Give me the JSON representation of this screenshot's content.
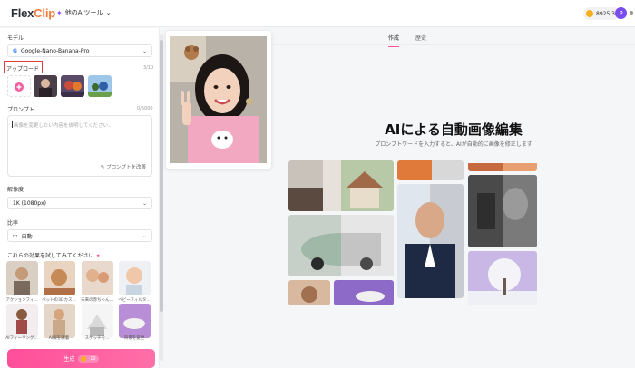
{
  "header": {
    "logo_main": "Flex",
    "logo_accent": "Clip",
    "tools_menu": "他のAIツール",
    "credits": "8925.3",
    "avatar_initial": "P"
  },
  "left_panel": {
    "model_label": "モデル",
    "model_value": "Google-Nano-Banana-Pro",
    "upload_label": "アップロード",
    "upload_count": "3/10",
    "prompt_label": "プロンプト",
    "prompt_count": "0/5000",
    "prompt_placeholder": "画像を変更したい内容を説明してください...",
    "prompt_enhance": "プロンプトを改善",
    "resolution_label": "解像度",
    "resolution_value": "1K (1080px)",
    "ratio_label": "比率",
    "ratio_value": "自動",
    "effects_title": "これらの効果を試してみてください",
    "effects": [
      {
        "label": "アクションフィ..."
      },
      {
        "label": "ペットの3Dカス..."
      },
      {
        "label": "未来の赤ちゃん..."
      },
      {
        "label": "ベビーフィルタ..."
      },
      {
        "label": "AIフィーリング..."
      },
      {
        "label": "AI服を試着"
      },
      {
        "label": "スケッチを..."
      },
      {
        "label": "背景を変更"
      }
    ],
    "generate_label": "生成",
    "generate_cost": "-10"
  },
  "main": {
    "tabs": [
      {
        "label": "作成"
      },
      {
        "label": "歴史"
      }
    ],
    "hero_title": "AIによる自動画像編集",
    "hero_subtitle": "プロンプトワードを入力すると、AIが自動的に画像を修正します"
  },
  "colors": {
    "accent": "#ff4f9a",
    "brand_orange": "#f27a3a",
    "highlight_red": "#e03b3b"
  }
}
